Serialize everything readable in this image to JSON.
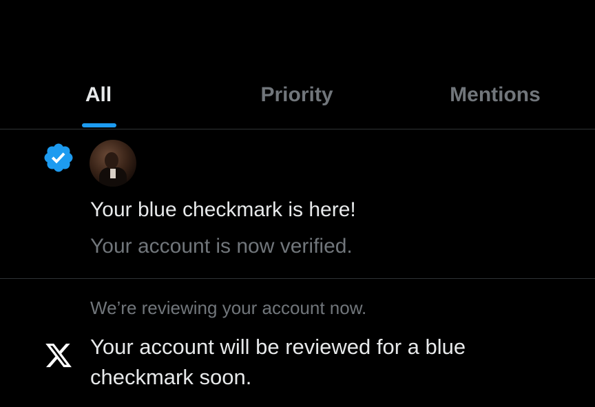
{
  "tabs": {
    "all": "All",
    "priority": "Priority",
    "mentions": "Mentions",
    "active": "All"
  },
  "notifications": [
    {
      "icon": "verified-badge-icon",
      "title": "Your blue checkmark is here!",
      "subtitle": "Your account is now verified."
    },
    {
      "icon": "x-logo-icon",
      "header": "We’re reviewing your account now.",
      "body": "Your account will be reviewed for a blue checkmark soon."
    }
  ],
  "colors": {
    "background": "#000000",
    "accent": "#1d9bf0",
    "primary_text": "#e7e9ea",
    "secondary_text": "#71767b",
    "divider": "#2f3336"
  }
}
